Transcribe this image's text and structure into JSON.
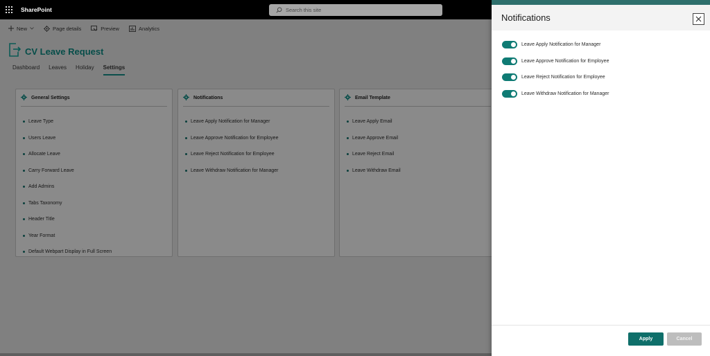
{
  "suite": {
    "brand": "SharePoint",
    "search_placeholder": "Search this site"
  },
  "commands": [
    {
      "icon": "plus-icon",
      "label": "New"
    },
    {
      "icon": "gear-icon",
      "label": "Page details"
    },
    {
      "icon": "preview-icon",
      "label": "Preview"
    },
    {
      "icon": "analytics-icon",
      "label": "Analytics"
    }
  ],
  "page": {
    "title": "CV Leave Request"
  },
  "tabs": [
    "Dashboard",
    "Leaves",
    "Holiday",
    "Settings"
  ],
  "active_tab": "Settings",
  "cards": [
    {
      "title": "General Settings",
      "items": [
        "Leave Type",
        "Users Leave",
        "Allocate Leave",
        "Carry Forward Leave",
        "Add Admins",
        "Tabs Taxonomy",
        "Header Title",
        "Year Format",
        "Default Webpart Display in Full Screen"
      ]
    },
    {
      "title": "Notifications",
      "items": [
        "Leave Apply Notification for Manager",
        "Leave Approve Notification for Employee",
        "Leave Reject Notification for Employee",
        "Leave Withdraw Notification for Manager"
      ]
    },
    {
      "title": "Email Template",
      "items": [
        "Leave Apply Email",
        "Leave Approve Email",
        "Leave Reject Email",
        "Leave Withdraw Email"
      ]
    }
  ],
  "panel": {
    "title": "Notifications",
    "toggles": [
      {
        "label": "Leave Apply Notification for Manager",
        "on": true
      },
      {
        "label": "Leave Approve Notification for Employee",
        "on": true
      },
      {
        "label": "Leave Reject Notification for Employee",
        "on": true
      },
      {
        "label": "Leave Withdraw Notification for Manager",
        "on": true
      }
    ],
    "apply_label": "Apply",
    "cancel_label": "Cancel"
  },
  "colors": {
    "accent": "#0f6f6a",
    "title": "#064d49"
  }
}
